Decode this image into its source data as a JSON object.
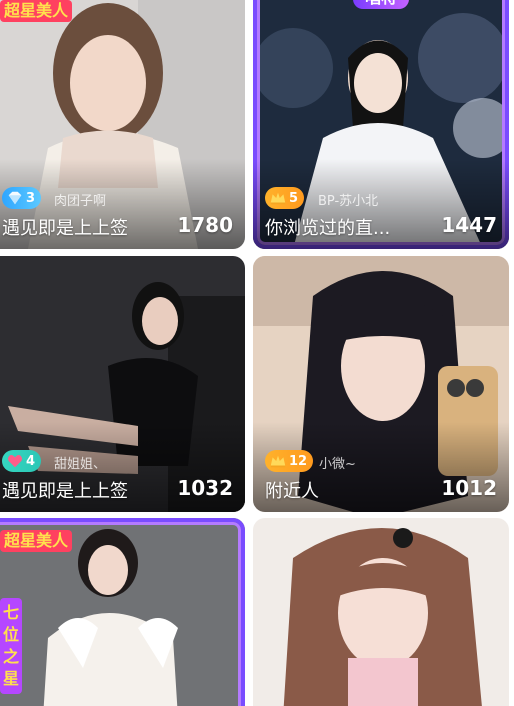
{
  "cards": [
    {
      "corner_tag": "超星美人",
      "badge": {
        "style": "blue",
        "icon": "diamond-icon",
        "level": "3"
      },
      "host": "肉团子啊",
      "subtitle": "遇见即是上上签",
      "viewers": "1780"
    },
    {
      "top_tag": "唱将",
      "badge": {
        "style": "gold",
        "icon": "crown-icon",
        "level": "5"
      },
      "host": "BP-苏小北",
      "subtitle": "你浏览过的直...",
      "viewers": "1447"
    },
    {
      "badge": {
        "style": "teal",
        "icon": "heart-icon",
        "level": "4"
      },
      "host": "甜姐姐、",
      "subtitle": "遇见即是上上签",
      "viewers": "1032"
    },
    {
      "badge": {
        "style": "gold",
        "icon": "crown-icon",
        "level": "12"
      },
      "host": "小微~",
      "subtitle": "附近人",
      "viewers": "1012"
    },
    {
      "corner_tag": "超星美人",
      "side_tag": "七位之星"
    },
    {}
  ],
  "colors": {
    "badge_blue": "#2fa6ff",
    "badge_gold": "#ffb22b",
    "badge_teal": "#36d6c0",
    "frame_purple": "#7a4cff"
  }
}
